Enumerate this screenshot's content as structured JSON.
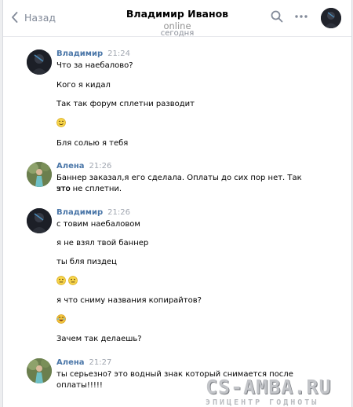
{
  "header": {
    "back_label": "Назад",
    "title": "Владимир Иванов",
    "status": "online",
    "search_icon": "search-icon",
    "more_icon": "more-icon"
  },
  "date_separator": "сегодня",
  "messages": [
    {
      "author": "Владимир",
      "time": "21:24",
      "avatar": "dark",
      "lines": [
        "Что за наебалово?",
        "Кого я кидал",
        "Так так форум сплетни разводит",
        "[smile]",
        "Бля солью я тебя"
      ]
    },
    {
      "author": "Алена",
      "time": "21:26",
      "avatar": "green",
      "lines": [
        "Баннер заказал,я его сделала. Оплаты до сих пор нет. Так что",
        "это не сплетни."
      ]
    },
    {
      "author": "Владимир",
      "time": "21:26",
      "avatar": "dark",
      "lines": [
        "с товим наебаловом",
        "я не взял твой баннер",
        "ты бля пиздец",
        "[neutral][neutral]",
        "я что сниму названия копирайтов?",
        "[laugh]",
        "Зачем так делаешь?"
      ]
    },
    {
      "author": "Алена",
      "time": "21:27",
      "avatar": "green",
      "lines": [
        "ты серьезно? это водный знак который снимается после",
        "оплаты!!!!!"
      ]
    }
  ],
  "watermark": {
    "line1": "CS-AMBA.RU",
    "line2": "ЭПИЦЕНТР ГОДНОТЫ"
  },
  "colors": {
    "link": "#4a76a8",
    "time": "#a0a6b0",
    "header_muted": "#828a99"
  }
}
